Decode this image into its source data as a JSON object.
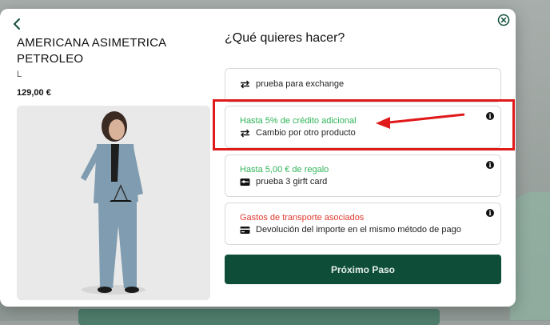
{
  "header": {
    "question": "¿Qué quieres hacer?"
  },
  "product": {
    "name": "AMERICANA ASIMETRICA PETROLEO",
    "size": "L",
    "price": "129,00 €"
  },
  "options": [
    {
      "label": "prueba para exchange",
      "note": "",
      "icon": "exchange-icon",
      "info": false
    },
    {
      "label": "Cambio por otro producto",
      "note": "Hasta 5% de crédito adicional",
      "note_color": "#32b45a",
      "icon": "exchange-icon",
      "info": true
    },
    {
      "label": "prueba 3 girft card",
      "note": "Hasta 5,00 € de regalo",
      "note_color": "#32b45a",
      "icon": "gift-card-icon",
      "info": true
    },
    {
      "label": "Devolución del importe en el mismo método de pago",
      "note": "Gastos de transporte asociados",
      "note_color": "#e03a2f",
      "icon": "credit-card-icon",
      "info": true
    }
  ],
  "next_button": {
    "label": "Próximo Paso"
  },
  "colors": {
    "primary": "#0e4e39",
    "accent_green": "#32b45a",
    "warning_red": "#e03a2f",
    "annotation_red": "#e01a1a"
  }
}
